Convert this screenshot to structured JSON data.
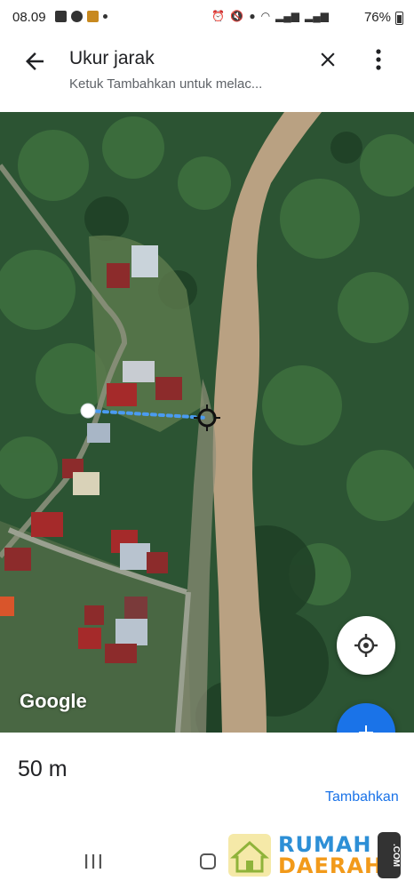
{
  "status_bar": {
    "time": "08.09",
    "left_icons": [
      "gallery-icon",
      "whatsapp-icon",
      "app-badge-icon",
      "dot-icon"
    ],
    "right_icons": [
      "alarm-icon",
      "mute-icon",
      "location-icon",
      "wifi-icon",
      "volte-lte1-icon",
      "signal-icon",
      "volte-lte2-icon",
      "signal-icon"
    ],
    "battery": "76%"
  },
  "header": {
    "title": "Ukur jarak",
    "subtitle": "Ketuk Tambahkan untuk melac..."
  },
  "map": {
    "attribution": "Google",
    "measure_points": 2
  },
  "panel": {
    "distance": "50 m",
    "add_label": "Tambahkan"
  },
  "watermark": {
    "line1": "RUMAH",
    "line2": "DAERAH",
    "suffix": ".COM"
  },
  "colors": {
    "accent": "#1a73e8",
    "measure_line": "#4a9bf0"
  }
}
